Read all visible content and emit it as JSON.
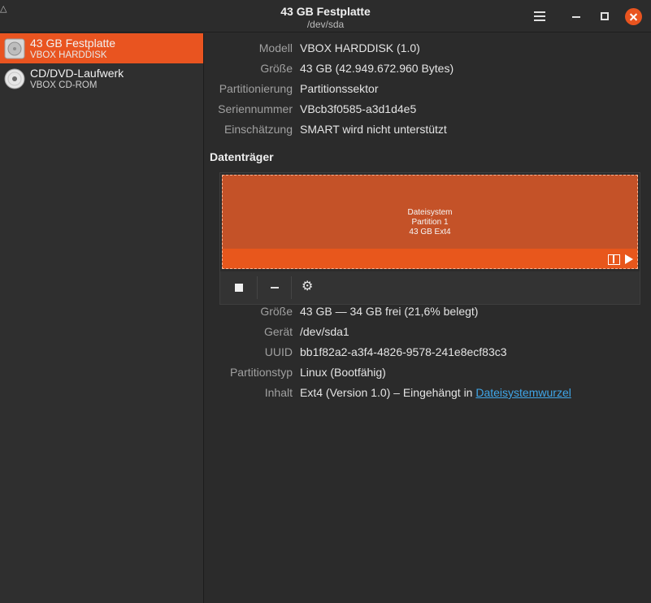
{
  "window": {
    "title": "43 GB Festplatte",
    "subtitle": "/dev/sda",
    "corner_glyph": "△"
  },
  "sidebar": {
    "items": [
      {
        "name": "43 GB Festplatte",
        "model": "VBOX HARDDISK",
        "icon": "harddisk-icon",
        "selected": true
      },
      {
        "name": "CD/DVD-Laufwerk",
        "model": "VBOX CD-ROM",
        "icon": "optical-disc-icon",
        "selected": false
      }
    ]
  },
  "drive": {
    "model_label": "Modell",
    "model_value": "VBOX HARDDISK (1.0)",
    "size_label": "Größe",
    "size_value": "43 GB (42.949.672.960 Bytes)",
    "partitioning_label": "Partitionierung",
    "partitioning_value": "Partitionssektor",
    "serial_label": "Seriennummer",
    "serial_value": "VBcb3f0585-a3d1d4e5",
    "assessment_label": "Einschätzung",
    "assessment_value": "SMART wird nicht unterstützt"
  },
  "volumes": {
    "section_title": "Datenträger",
    "partition": {
      "line1": "Dateisystem",
      "line2": "Partition 1",
      "line3": "43 GB Ext4"
    }
  },
  "partition_details": {
    "size_label": "Größe",
    "size_value": "43 GB — 34 GB frei (21,6% belegt)",
    "device_label": "Gerät",
    "device_value": "/dev/sda1",
    "uuid_label": "UUID",
    "uuid_value": "bb1f82a2-a3f4-4826-9578-241e8ecf83c3",
    "type_label": "Partitionstyp",
    "type_value": "Linux (Bootfähig)",
    "contents_label": "Inhalt",
    "contents_prefix": "Ext4 (Version 1.0) – Eingehängt in ",
    "contents_link": "Dateisystemwurzel"
  },
  "colors": {
    "accent": "#e95420",
    "partition_fill": "#c45228",
    "link": "#3fa6e8",
    "close_button": "#e9541f"
  }
}
